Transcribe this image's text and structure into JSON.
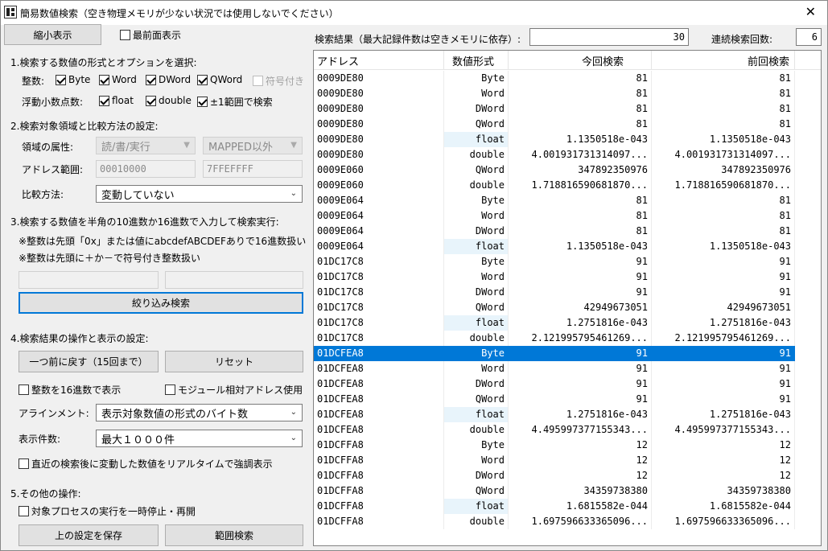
{
  "window": {
    "title": "簡易数値検索（空き物理メモリが少ない状況では使用しないでください）",
    "close_glyph": "✕"
  },
  "top": {
    "shrink_button": "縮小表示",
    "topmost_label": "最前面表示",
    "topmost_checked": false
  },
  "section1": {
    "title": "1.検索する数値の形式とオプションを選択:",
    "int_label": "整数:",
    "int_options": [
      {
        "label": "Byte",
        "checked": true
      },
      {
        "label": "Word",
        "checked": true
      },
      {
        "label": "DWord",
        "checked": true
      },
      {
        "label": "QWord",
        "checked": true
      },
      {
        "label": "符号付き",
        "checked": false
      }
    ],
    "float_label": "浮動小数点数:",
    "float_options": [
      {
        "label": "float",
        "checked": true
      },
      {
        "label": "double",
        "checked": true
      },
      {
        "label": "±1範囲で検索",
        "checked": true
      }
    ]
  },
  "section2": {
    "title": "2.検索対象領域と比較方法の設定:",
    "region_label": "領域の属性:",
    "region_attr": "読/書/実行",
    "region_type": "MAPPED以外",
    "addr_label": "アドレス範囲:",
    "addr_from": "00010000",
    "addr_to": "7FFEFFFF",
    "compare_label": "比較方法:",
    "compare_value": "変動していない"
  },
  "section3": {
    "title": "3.検索する数値を半角の10進数か16進数で入力して検索実行:",
    "note1": "※整数は先頭「0x」または値にabcdefABCDEFありで16進数扱い",
    "note2": "※整数は先頭に＋か－で符号付き整数扱い",
    "input1": "",
    "input2": "",
    "search_button": "絞り込み検索"
  },
  "section4": {
    "title": "4.検索結果の操作と表示の設定:",
    "back_button": "一つ前に戻す（15回まで）",
    "reset_button": "リセット",
    "hex_label": "整数を16進数で表示",
    "module_label": "モジュール相対アドレス使用",
    "align_label": "アラインメント:",
    "align_value": "表示対象数値の形式のバイト数",
    "count_label": "表示件数:",
    "count_value": "最大１０００件",
    "realtime_label": "直近の検索後に変動した数値をリアルタイムで強調表示"
  },
  "section5": {
    "title": "5.その他の操作:",
    "pause_label": "対象プロセスの実行を一時停止・再開",
    "save_button": "上の設定を保存",
    "range_button": "範囲検索"
  },
  "results": {
    "caption": "検索結果（最大記録件数は空きメモリに依存）:",
    "max_records": "30",
    "count_caption": "連続検索回数:",
    "count": "6",
    "columns": [
      "アドレス",
      "数値形式",
      "今回検索",
      "前回検索"
    ],
    "selected_index": 18,
    "rows": [
      [
        "0009DE80",
        "Byte",
        "81",
        "81"
      ],
      [
        "0009DE80",
        "Word",
        "81",
        "81"
      ],
      [
        "0009DE80",
        "DWord",
        "81",
        "81"
      ],
      [
        "0009DE80",
        "QWord",
        "81",
        "81"
      ],
      [
        "0009DE80",
        "float",
        "1.1350518e-043",
        "1.1350518e-043"
      ],
      [
        "0009DE80",
        "double",
        "4.001931731314097...",
        "4.001931731314097..."
      ],
      [
        "0009E060",
        "QWord",
        "347892350976",
        "347892350976"
      ],
      [
        "0009E060",
        "double",
        "1.718816590681870...",
        "1.718816590681870..."
      ],
      [
        "0009E064",
        "Byte",
        "81",
        "81"
      ],
      [
        "0009E064",
        "Word",
        "81",
        "81"
      ],
      [
        "0009E064",
        "DWord",
        "81",
        "81"
      ],
      [
        "0009E064",
        "float",
        "1.1350518e-043",
        "1.1350518e-043"
      ],
      [
        "01DC17C8",
        "Byte",
        "91",
        "91"
      ],
      [
        "01DC17C8",
        "Word",
        "91",
        "91"
      ],
      [
        "01DC17C8",
        "DWord",
        "91",
        "91"
      ],
      [
        "01DC17C8",
        "QWord",
        "42949673051",
        "42949673051"
      ],
      [
        "01DC17C8",
        "float",
        "1.2751816e-043",
        "1.2751816e-043"
      ],
      [
        "01DC17C8",
        "double",
        "2.121995795461269...",
        "2.121995795461269..."
      ],
      [
        "01DCFEA8",
        "Byte",
        "91",
        "91"
      ],
      [
        "01DCFEA8",
        "Word",
        "91",
        "91"
      ],
      [
        "01DCFEA8",
        "DWord",
        "91",
        "91"
      ],
      [
        "01DCFEA8",
        "QWord",
        "91",
        "91"
      ],
      [
        "01DCFEA8",
        "float",
        "1.2751816e-043",
        "1.2751816e-043"
      ],
      [
        "01DCFEA8",
        "double",
        "4.495997377155343...",
        "4.495997377155343..."
      ],
      [
        "01DCFFA8",
        "Byte",
        "12",
        "12"
      ],
      [
        "01DCFFA8",
        "Word",
        "12",
        "12"
      ],
      [
        "01DCFFA8",
        "DWord",
        "12",
        "12"
      ],
      [
        "01DCFFA8",
        "QWord",
        "34359738380",
        "34359738380"
      ],
      [
        "01DCFFA8",
        "float",
        "1.6815582e-044",
        "1.6815582e-044"
      ],
      [
        "01DCFFA8",
        "double",
        "1.697596633365096...",
        "1.697596633365096..."
      ]
    ]
  },
  "colors": {
    "selection": "#0078d7",
    "float_cell_tint": "#e8f4fb",
    "focus_border": "#0078d7"
  }
}
